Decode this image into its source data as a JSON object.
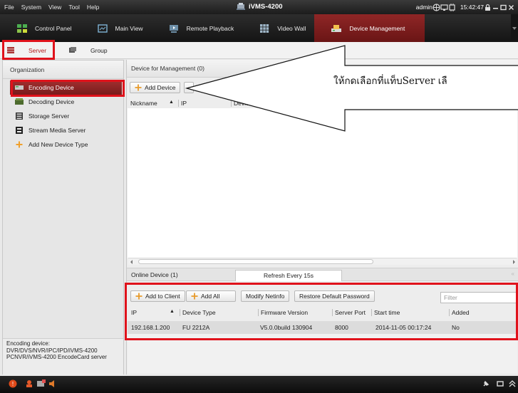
{
  "titlebar": {
    "menu": [
      "File",
      "System",
      "View",
      "Tool",
      "Help"
    ],
    "app_title": "iVMS-4200",
    "user": "admin",
    "time": "15:42:47"
  },
  "toolbar": {
    "items": [
      {
        "label": "Control Panel",
        "icon": "control-panel-icon"
      },
      {
        "label": "Main View",
        "icon": "main-view-icon"
      },
      {
        "label": "Remote Playback",
        "icon": "remote-playback-icon"
      },
      {
        "label": "Video Wall",
        "icon": "video-wall-icon"
      },
      {
        "label": "Device Management",
        "icon": "device-management-icon",
        "active": true
      }
    ]
  },
  "tabs": {
    "server": "Server",
    "group": "Group"
  },
  "left_panel": {
    "header": "Organization",
    "tree": [
      {
        "label": "Encoding Device",
        "selected": true
      },
      {
        "label": "Decoding Device"
      },
      {
        "label": "Storage Server"
      },
      {
        "label": "Stream Media Server"
      },
      {
        "label": "Add New Device Type"
      }
    ],
    "footer": "Encoding device: DVR/DVS/NVR/IPC/IPD/iVMS-4200 PCNVR/iVMS-4200 EncodeCard server"
  },
  "main": {
    "header": "Device for Management (0)",
    "add_device": "Add Device",
    "columns": {
      "nickname": "Nickname",
      "ip": "IP",
      "device": "Device"
    },
    "online_title": "Online Device (1)",
    "refresh": "Refresh Every 15s",
    "buttons": {
      "add_to_client": "Add to Client",
      "add_all": "Add All",
      "modify_netinfo": "Modify Netinfo",
      "restore_password": "Restore Default Password"
    },
    "filter_placeholder": "Filter",
    "online_columns": {
      "ip": "IP",
      "device_type": "Device Type",
      "firmware": "Firmware Version",
      "server_port": "Server Port",
      "start_time": "Start time",
      "added": "Added"
    },
    "online_rows": [
      {
        "ip": "192.168.1.200",
        "device_type": "FU 2212A",
        "firmware": "V5.0.0build 130904",
        "server_port": "8000",
        "start_time": "2014-11-05 00:17:24",
        "added": "No"
      }
    ]
  },
  "annotation": {
    "text": "ให้กดเลือกที่แท็บServer เลื"
  },
  "colors": {
    "accent_red": "#e0121b",
    "active_tab": "#8f2626"
  }
}
